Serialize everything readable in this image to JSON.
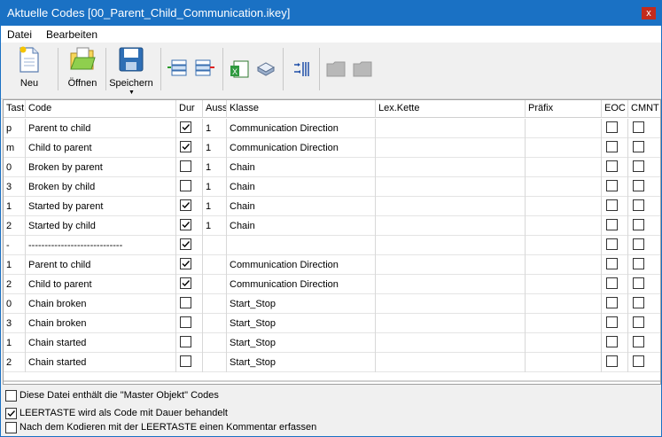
{
  "window": {
    "title": "Aktuelle Codes [00_Parent_Child_Communication.ikey]",
    "close": "x"
  },
  "menu": {
    "items": [
      "Datei",
      "Bearbeiten"
    ]
  },
  "toolbar": {
    "neu": "Neu",
    "oeffnen": "Öffnen",
    "speichern": "Speichern"
  },
  "columns": [
    "Tast",
    "Code",
    "Dur",
    "Auss",
    "Klasse",
    "Lex.Kette",
    "Präfix",
    "EOC",
    "CMNT"
  ],
  "rows": [
    {
      "tast": "p",
      "code": "Parent to child",
      "dur": true,
      "auss": "1",
      "klasse": "Communication Direction"
    },
    {
      "tast": "m",
      "code": "Child to parent",
      "dur": true,
      "auss": "1",
      "klasse": "Communication Direction"
    },
    {
      "tast": "0",
      "code": "Broken by parent",
      "dur": false,
      "auss": "1",
      "klasse": "Chain"
    },
    {
      "tast": "3",
      "code": "Broken by child",
      "dur": false,
      "auss": "1",
      "klasse": "Chain"
    },
    {
      "tast": "1",
      "code": "Started by parent",
      "dur": true,
      "auss": "1",
      "klasse": "Chain"
    },
    {
      "tast": "2",
      "code": "Started by child",
      "dur": true,
      "auss": "1",
      "klasse": "Chain"
    },
    {
      "tast": "-",
      "code": "-----------------------------",
      "dur": true,
      "auss": "",
      "klasse": ""
    },
    {
      "tast": "1",
      "code": "Parent to child",
      "dur": true,
      "auss": "",
      "klasse": "Communication Direction"
    },
    {
      "tast": "2",
      "code": "Child to parent",
      "dur": true,
      "auss": "",
      "klasse": "Communication Direction"
    },
    {
      "tast": "0",
      "code": "Chain broken",
      "dur": false,
      "auss": "",
      "klasse": "Start_Stop"
    },
    {
      "tast": "3",
      "code": "Chain broken",
      "dur": false,
      "auss": "",
      "klasse": "Start_Stop"
    },
    {
      "tast": "1",
      "code": "Chain started",
      "dur": false,
      "auss": "",
      "klasse": "Start_Stop"
    },
    {
      "tast": "2",
      "code": "Chain started",
      "dur": false,
      "auss": "",
      "klasse": "Start_Stop"
    }
  ],
  "options": [
    {
      "label": "Diese Datei enthält die \"Master Objekt\" Codes",
      "checked": false
    },
    {
      "label": "LEERTASTE wird als Code mit Dauer behandelt",
      "checked": true
    },
    {
      "label": "Nach dem Kodieren mit der LEERTASTE einen Kommentar erfassen",
      "checked": false
    }
  ]
}
